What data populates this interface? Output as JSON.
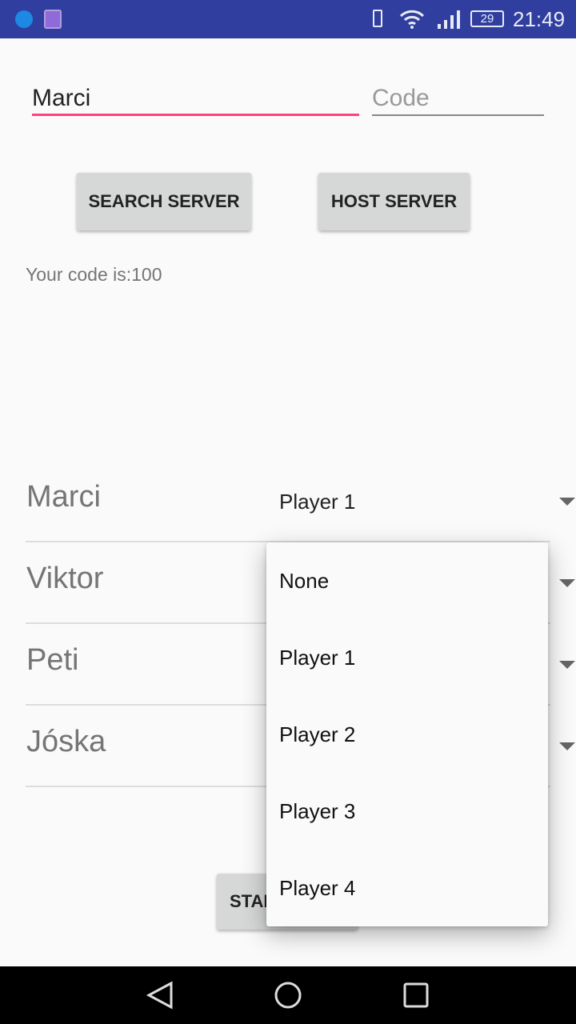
{
  "status_bar": {
    "time": "21:49",
    "battery": "29",
    "icons": [
      "messenger-icon",
      "gallery-icon",
      "vibrate-icon",
      "wifi-icon",
      "signal-icon",
      "battery-icon"
    ]
  },
  "form": {
    "name_value": "Marci",
    "code_placeholder": "Code",
    "accent": "#ff4081"
  },
  "buttons": {
    "search": "SEARCH SERVER",
    "host": "HOST SERVER",
    "start": "START"
  },
  "code_text": "Your code is:100",
  "players": [
    {
      "name": "Marci",
      "selection": "Player 1"
    },
    {
      "name": "Viktor"
    },
    {
      "name": "Peti"
    },
    {
      "name": "Jóska"
    }
  ],
  "dropdown": {
    "options": [
      "None",
      "Player 1",
      "Player 2",
      "Player 3",
      "Player 4"
    ]
  },
  "nav": [
    "back-icon",
    "home-icon",
    "recents-icon"
  ]
}
